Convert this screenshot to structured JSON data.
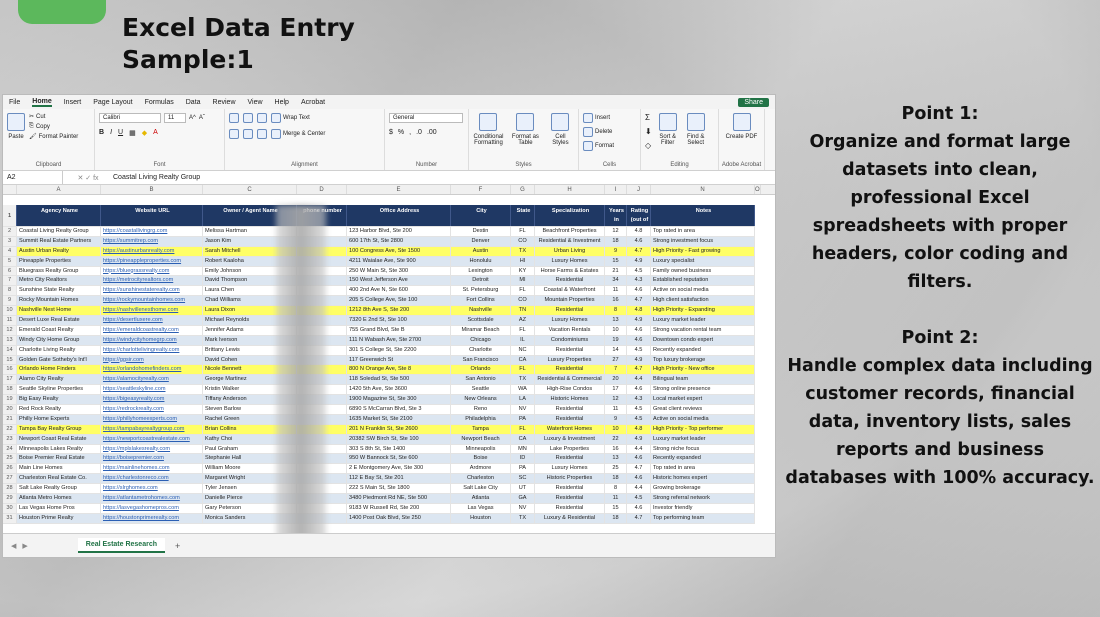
{
  "title_line1": "Excel Data Entry",
  "title_line2": "Sample:1",
  "points": [
    {
      "heading": "Point 1:",
      "body": "Organize and format large datasets into clean, professional Excel spreadsheets with proper headers, color coding and filters."
    },
    {
      "heading": "Point 2:",
      "body": "Handle complex data including customer records, financial data, inventory lists, sales reports and business databases with 100% accuracy."
    }
  ],
  "excel": {
    "menu": [
      "File",
      "Home",
      "Insert",
      "Page Layout",
      "Formulas",
      "Data",
      "Review",
      "View",
      "Help",
      "Acrobat"
    ],
    "share": "Share",
    "ribbon": {
      "paste": "Paste",
      "cut": "Cut",
      "copy": "Copy",
      "format_painter": "Format Painter",
      "clipboard": "Clipboard",
      "font_name": "Calibri",
      "font_size": "11",
      "font": "Font",
      "wrap": "Wrap Text",
      "merge": "Merge & Center",
      "alignment": "Alignment",
      "number_format": "General",
      "number": "Number",
      "cond": "Conditional Formatting",
      "format_table": "Format as Table",
      "cell_styles": "Cell Styles",
      "styles": "Styles",
      "insert": "Insert",
      "delete": "Delete",
      "format": "Format",
      "cells": "Cells",
      "sort": "Sort & Filter",
      "find": "Find & Select",
      "editing": "Editing",
      "create_pdf": "Create PDF",
      "adobe": "Adobe Acrobat"
    },
    "name_box": "A2",
    "formula": "Coastal Living Realty Group",
    "columns": [
      "A",
      "B",
      "C",
      "D",
      "E",
      "F",
      "G",
      "H",
      "I",
      "J",
      "N",
      "O"
    ],
    "headers": [
      "Agency Name",
      "Website URL",
      "Owner / Agent Name",
      "phone number",
      "Office Address",
      "City",
      "State",
      "Specialization",
      "Years in Business",
      "Rating (out of 5)",
      "Notes"
    ],
    "rows": [
      [
        "Coastal Living Realty Group",
        "https://coastallivingrg.com",
        "Melissa Hartman",
        "123 Harbor Blvd, Ste 200",
        "Destin",
        "FL",
        "Beachfront Properties",
        "12",
        "4.8",
        "Top rated in area"
      ],
      [
        "Summit Real Estate Partners",
        "https://summitrep.com",
        "Jason Kim",
        "600 17th St, Ste 2800",
        "Denver",
        "CO",
        "Residential & Investment",
        "18",
        "4.6",
        "Strong investment focus"
      ],
      [
        "Austin Urban Realty",
        "https://austinurbanrealty.com",
        "Sarah Mitchell",
        "100 Congress Ave, Ste 1500",
        "Austin",
        "TX",
        "Urban Living",
        "9",
        "4.7",
        "High Priority - Fast growing"
      ],
      [
        "Pineapple Properties",
        "https://pineappleproperties.com",
        "Robert Kaaloha",
        "4211 Waialae Ave, Ste 900",
        "Honolulu",
        "HI",
        "Luxury Homes",
        "15",
        "4.9",
        "Luxury specialist"
      ],
      [
        "Bluegrass Realty Group",
        "https://bluegrassrealty.com",
        "Emily Johnson",
        "250 W Main St, Ste 300",
        "Lexington",
        "KY",
        "Horse Farms & Estates",
        "21",
        "4.5",
        "Family owned business"
      ],
      [
        "Metro City Realtors",
        "https://metrocityrealtors.com",
        "David Thompson",
        "150 West Jefferson Ave",
        "Detroit",
        "MI",
        "Residential",
        "34",
        "4.3",
        "Established reputation"
      ],
      [
        "Sunshine State Realty",
        "https://sunshinestaterealty.com",
        "Laura Chen",
        "400 2nd Ave N, Ste 600",
        "St. Petersburg",
        "FL",
        "Coastal & Waterfront",
        "11",
        "4.6",
        "Active on social media"
      ],
      [
        "Rocky Mountain Homes",
        "https://rockymountainhomes.com",
        "Chad Williams",
        "205 S College Ave, Ste 100",
        "Fort Collins",
        "CO",
        "Mountain Properties",
        "16",
        "4.7",
        "High client satisfaction"
      ],
      [
        "Nashville Nest Home",
        "https://nashvillenesthome.com",
        "Laura Dixon",
        "1212 8th Ave S, Ste 200",
        "Nashville",
        "TN",
        "Residential",
        "8",
        "4.8",
        "High Priority - Expanding"
      ],
      [
        "Desert Luxe Real Estate",
        "https://desertluxere.com",
        "Michael Reynolds",
        "7320 E 2nd St, Ste 100",
        "Scottsdale",
        "AZ",
        "Luxury Homes",
        "13",
        "4.9",
        "Luxury market leader"
      ],
      [
        "Emerald Coast Realty",
        "https://emeraldcoastrealty.com",
        "Jennifer Adams",
        "755 Grand Blvd, Ste B",
        "Miramar Beach",
        "FL",
        "Vacation Rentals",
        "10",
        "4.6",
        "Strong vacation rental team"
      ],
      [
        "Windy City Home Group",
        "https://windycityhomegrp.com",
        "Mark Iverson",
        "111 N Wabash Ave, Ste 2700",
        "Chicago",
        "IL",
        "Condominiums",
        "19",
        "4.6",
        "Downtown condo expert"
      ],
      [
        "Charlotte Living Realty",
        "https://charlottelivingrealty.com",
        "Brittany Lewis",
        "301 S College St, Ste 2200",
        "Charlotte",
        "NC",
        "Residential",
        "14",
        "4.5",
        "Recently expanded"
      ],
      [
        "Golden Gate Sotheby's Int'l",
        "https://ggsir.com",
        "David Cohen",
        "117 Greenwich St",
        "San Francisco",
        "CA",
        "Luxury Properties",
        "27",
        "4.9",
        "Top luxury brokerage"
      ],
      [
        "Orlando Home Finders",
        "https://orlandohomefinders.com",
        "Nicole Bennett",
        "800 N Orange Ave, Ste 8",
        "Orlando",
        "FL",
        "Residential",
        "7",
        "4.7",
        "High Priority - New office"
      ],
      [
        "Alamo City Realty",
        "https://alamocityrealty.com",
        "George Martinez",
        "118 Soledad St, Ste 500",
        "San Antonio",
        "TX",
        "Residential & Commercial",
        "20",
        "4.4",
        "Bilingual team"
      ],
      [
        "Seattle Skyline Properties",
        "https://seattleskyline.com",
        "Kristin Walker",
        "1420 5th Ave, Ste 3600",
        "Seattle",
        "WA",
        "High-Rise Condos",
        "17",
        "4.6",
        "Strong online presence"
      ],
      [
        "Big Easy Realty",
        "https://bigeasyrealty.com",
        "Tiffany Anderson",
        "1900 Magazine St, Ste 300",
        "New Orleans",
        "LA",
        "Historic Homes",
        "12",
        "4.3",
        "Local market expert"
      ],
      [
        "Red Rock Realty",
        "https://redrockrealty.com",
        "Steven Barlow",
        "6890 S McCarran Blvd, Ste 3",
        "Reno",
        "NV",
        "Residential",
        "11",
        "4.5",
        "Great client reviews"
      ],
      [
        "Philly Home Experts",
        "https://phillyhomeexperts.com",
        "Rachel Green",
        "1635 Market St, Ste 2100",
        "Philadelphia",
        "PA",
        "Residential",
        "9",
        "4.5",
        "Active on social media"
      ],
      [
        "Tampa Bay Realty Group",
        "https://tampabayrealtygroup.com",
        "Brian Collins",
        "201 N Franklin St, Ste 2600",
        "Tampa",
        "FL",
        "Waterfront Homes",
        "10",
        "4.8",
        "High Priority - Top performer"
      ],
      [
        "Newport Coast Real Estate",
        "https://newportcoastrealestate.com",
        "Kathy Choi",
        "20382 SW Birch St, Ste 100",
        "Newport Beach",
        "CA",
        "Luxury & Investment",
        "22",
        "4.9",
        "Luxury market leader"
      ],
      [
        "Minneapolis Lakes Realty",
        "https://mplslakesrealty.com",
        "Paul Graham",
        "303 S 8th St, Ste 1400",
        "Minneapolis",
        "MN",
        "Lake Properties",
        "16",
        "4.4",
        "Strong niche focus"
      ],
      [
        "Boise Premier Real Estate",
        "https://boisepremier.com",
        "Stephanie Hall",
        "950 W Bannock St, Ste 600",
        "Boise",
        "ID",
        "Residential",
        "13",
        "4.6",
        "Recently expanded"
      ],
      [
        "Main Line Homes",
        "https://mainlinehomes.com",
        "William Moore",
        "2 E Montgomery Ave, Ste 300",
        "Ardmore",
        "PA",
        "Luxury Homes",
        "25",
        "4.7",
        "Top rated in area"
      ],
      [
        "Charleston Real Estate Co.",
        "https://charlestonreco.com",
        "Margaret Wright",
        "112 E Bay St, Ste 201",
        "Charleston",
        "SC",
        "Historic Properties",
        "18",
        "4.6",
        "Historic homes expert"
      ],
      [
        "Salt Lake Realty Group",
        "https://slrghomes.com",
        "Tyler Jensen",
        "222 S Main St, Ste 1800",
        "Salt Lake City",
        "UT",
        "Residential",
        "8",
        "4.4",
        "Growing brokerage"
      ],
      [
        "Atlanta Metro Homes",
        "https://atlantametrohomes.com",
        "Danielle Pierce",
        "3480 Piedmont Rd NE, Ste 500",
        "Atlanta",
        "GA",
        "Residential",
        "11",
        "4.5",
        "Strong referral network"
      ],
      [
        "Las Vegas Home Pros",
        "https://lasvegashomepros.com",
        "Gary Peterson",
        "9183 W Russell Rd, Ste 200",
        "Las Vegas",
        "NV",
        "Residential",
        "15",
        "4.6",
        "Investor friendly"
      ],
      [
        "Houston Prime Realty",
        "https://houstonprimerealty.com",
        "Monica Sanders",
        "1400 Post Oak Blvd, Ste 250",
        "Houston",
        "TX",
        "Luxury & Residential",
        "18",
        "4.7",
        "Top performing team"
      ]
    ],
    "highlight_rows": [
      2,
      8,
      14,
      20
    ],
    "sheet_tab": "Real Estate Research",
    "add_sheet": "+"
  }
}
